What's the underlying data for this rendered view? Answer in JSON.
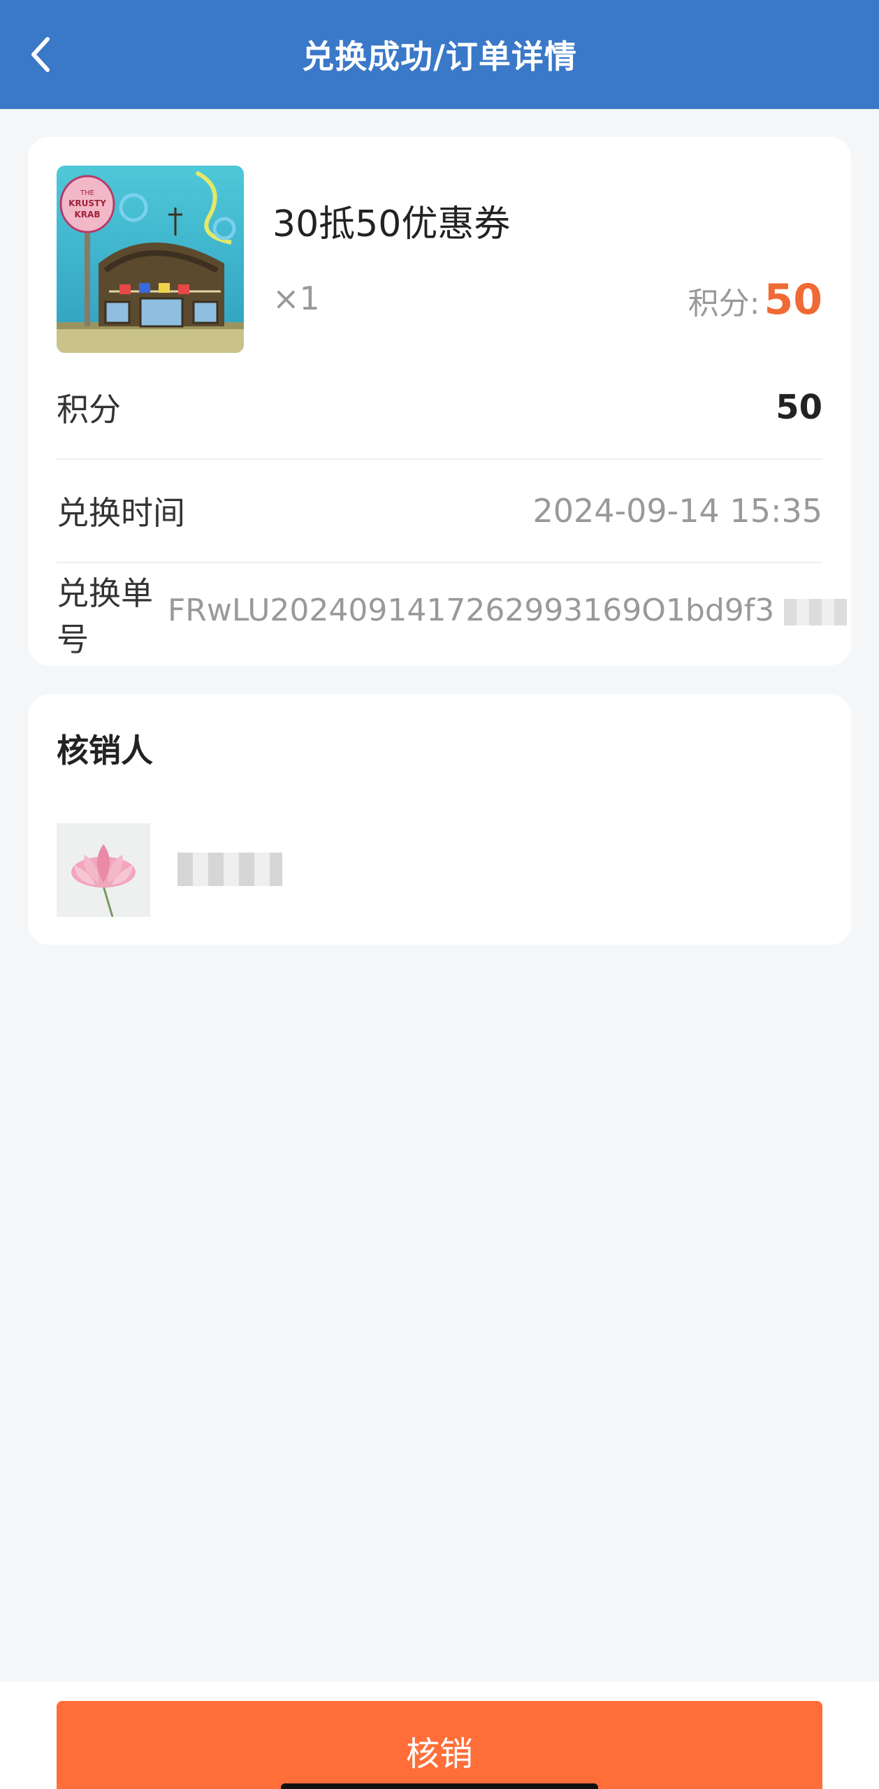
{
  "header": {
    "title": "兑换成功/订单详情",
    "back_icon": "chevron-left-icon"
  },
  "product": {
    "name": "30抵50优惠券",
    "quantity": "×1",
    "points_label": "积分:",
    "points_value": "50",
    "image_logo_text": "THE KRUSTY KRAB"
  },
  "details": {
    "points": {
      "label": "积分",
      "value": "50"
    },
    "exchange_time": {
      "label": "兑换时间",
      "value": "2024-09-14 15:35"
    },
    "order_no": {
      "label": "兑换单号",
      "value": "FRwLU2024091417262993169O1bd9f3"
    }
  },
  "verifier": {
    "section_title": "核销人"
  },
  "footer": {
    "verify_button": "核销"
  },
  "colors": {
    "header_bg": "#3a78c8",
    "accent": "#f06a36",
    "button_bg": "#ff6e39",
    "page_bg": "#f4f6f8"
  }
}
